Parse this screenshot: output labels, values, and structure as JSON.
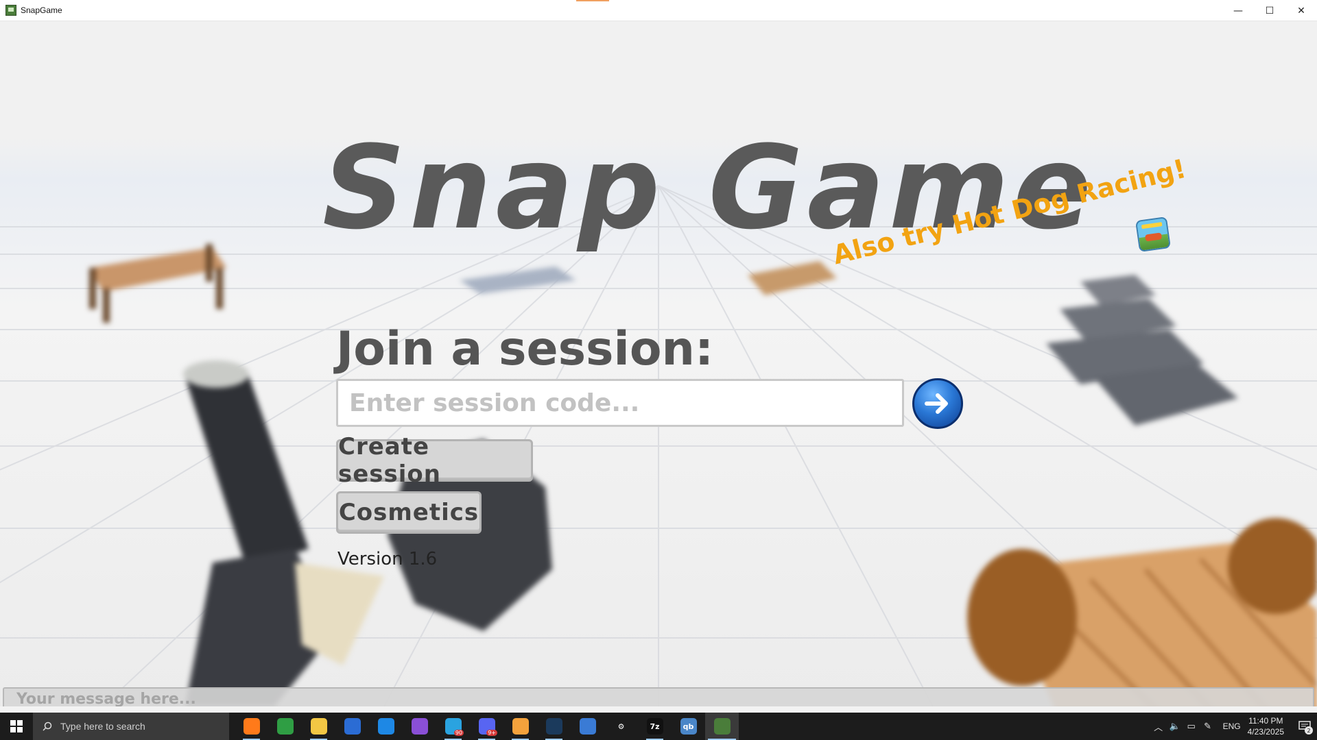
{
  "window": {
    "title": "SnapGame",
    "minimize_glyph": "—",
    "maximize_glyph": "☐",
    "close_glyph": "✕"
  },
  "menu": {
    "game_title": "Snap Game",
    "promo_text": "Also try Hot Dog Racing!",
    "promo_icon": "hot-dog-racing-app-icon",
    "join_heading": "Join a session:",
    "session_input_placeholder": "Enter session code...",
    "session_input_value": "",
    "go_icon": "arrow-right-icon",
    "create_session_label": "Create session",
    "cosmetics_label": "Cosmetics",
    "version_text": "Version 1.6"
  },
  "chat": {
    "placeholder": "Your message here..."
  },
  "taskbar": {
    "search_placeholder": "Type here to search",
    "apps": [
      {
        "name": "firefox",
        "color": "#ff7a1a",
        "glyph": "",
        "running": true
      },
      {
        "name": "chrome",
        "color": "#2f9e44",
        "glyph": "",
        "running": false
      },
      {
        "name": "file-explorer",
        "color": "#f2c744",
        "glyph": "",
        "running": true
      },
      {
        "name": "microsoft-store",
        "color": "#2b6cd4",
        "glyph": "",
        "running": false
      },
      {
        "name": "vs-code",
        "color": "#1e88e5",
        "glyph": "",
        "running": false
      },
      {
        "name": "visual-studio",
        "color": "#8a4fd6",
        "glyph": "",
        "running": false
      },
      {
        "name": "telegram",
        "color": "#2aa3e0",
        "glyph": "",
        "running": true,
        "badge": "90"
      },
      {
        "name": "discord",
        "color": "#5865f2",
        "glyph": "",
        "running": true,
        "badge": "9+"
      },
      {
        "name": "paint",
        "color": "#f4a23c",
        "glyph": "",
        "running": true
      },
      {
        "name": "steam",
        "color": "#1b3a5c",
        "glyph": "",
        "running": true
      },
      {
        "name": "task-manager",
        "color": "#3a7bd5",
        "glyph": "",
        "running": false
      },
      {
        "name": "settings",
        "color": "#1c1c1c",
        "glyph": "⚙",
        "running": false
      },
      {
        "name": "7zip",
        "color": "#111111",
        "glyph": "7z",
        "running": true
      },
      {
        "name": "qbittorrent",
        "color": "#4a86c8",
        "glyph": "qb",
        "running": false
      },
      {
        "name": "snapgame",
        "color": "#4a7d3a",
        "glyph": "",
        "running": true,
        "active": true
      }
    ],
    "language": "ENG",
    "time": "11:40 PM",
    "date": "4/23/2025",
    "notification_count": "2"
  }
}
